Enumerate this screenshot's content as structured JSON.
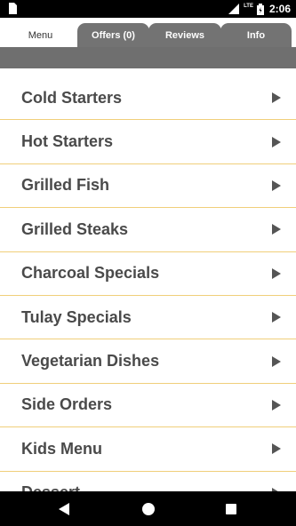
{
  "status_bar": {
    "network": "LTE",
    "time": "2:06"
  },
  "tabs": [
    {
      "label": "Menu"
    },
    {
      "label": "Offers (0)"
    },
    {
      "label": "Reviews"
    },
    {
      "label": "Info"
    }
  ],
  "menu": {
    "items": [
      {
        "label": "Cold Starters"
      },
      {
        "label": "Hot Starters"
      },
      {
        "label": "Grilled Fish"
      },
      {
        "label": "Grilled Steaks"
      },
      {
        "label": "Charcoal Specials"
      },
      {
        "label": "Tulay Specials"
      },
      {
        "label": "Vegetarian Dishes"
      },
      {
        "label": "Side Orders"
      },
      {
        "label": "Kids Menu"
      },
      {
        "label": "Dessert"
      }
    ]
  },
  "colors": {
    "tab_inactive": "#737373",
    "divider": "#f0cf7a",
    "label": "#4a4a4a"
  }
}
